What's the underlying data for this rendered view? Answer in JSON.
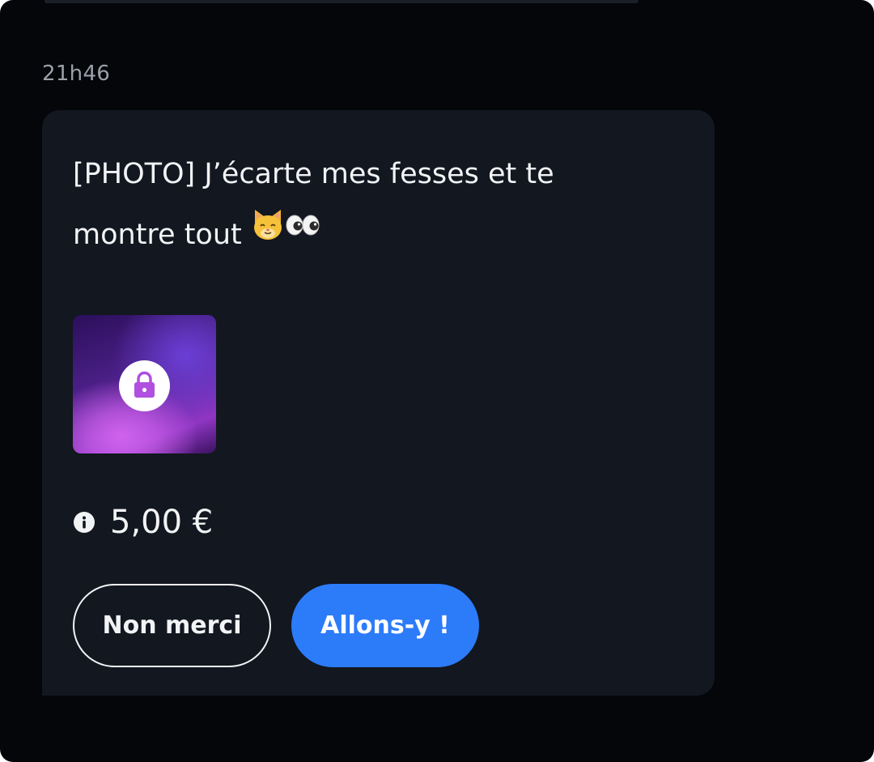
{
  "chat": {
    "timestamp": "21h46",
    "message": {
      "text_line1": "[PHOTO] J’écarte mes fesses et te",
      "text_line2": "montre tout ",
      "emojis": [
        "🐱",
        "👀"
      ]
    },
    "locked_media": {
      "icon": "lock-icon",
      "colors": [
        "#2a0f5a",
        "#8f36c4",
        "#d063ee"
      ]
    },
    "price": {
      "icon": "info-icon",
      "amount": "5,00 €"
    },
    "buttons": {
      "decline_label": "Non merci",
      "accept_label": "Allons-y !"
    }
  },
  "colors": {
    "background": "#04060a",
    "card": "#121720",
    "accent": "#2c7cfa",
    "text": "#f2f3f5",
    "muted": "#9ba0a8"
  }
}
